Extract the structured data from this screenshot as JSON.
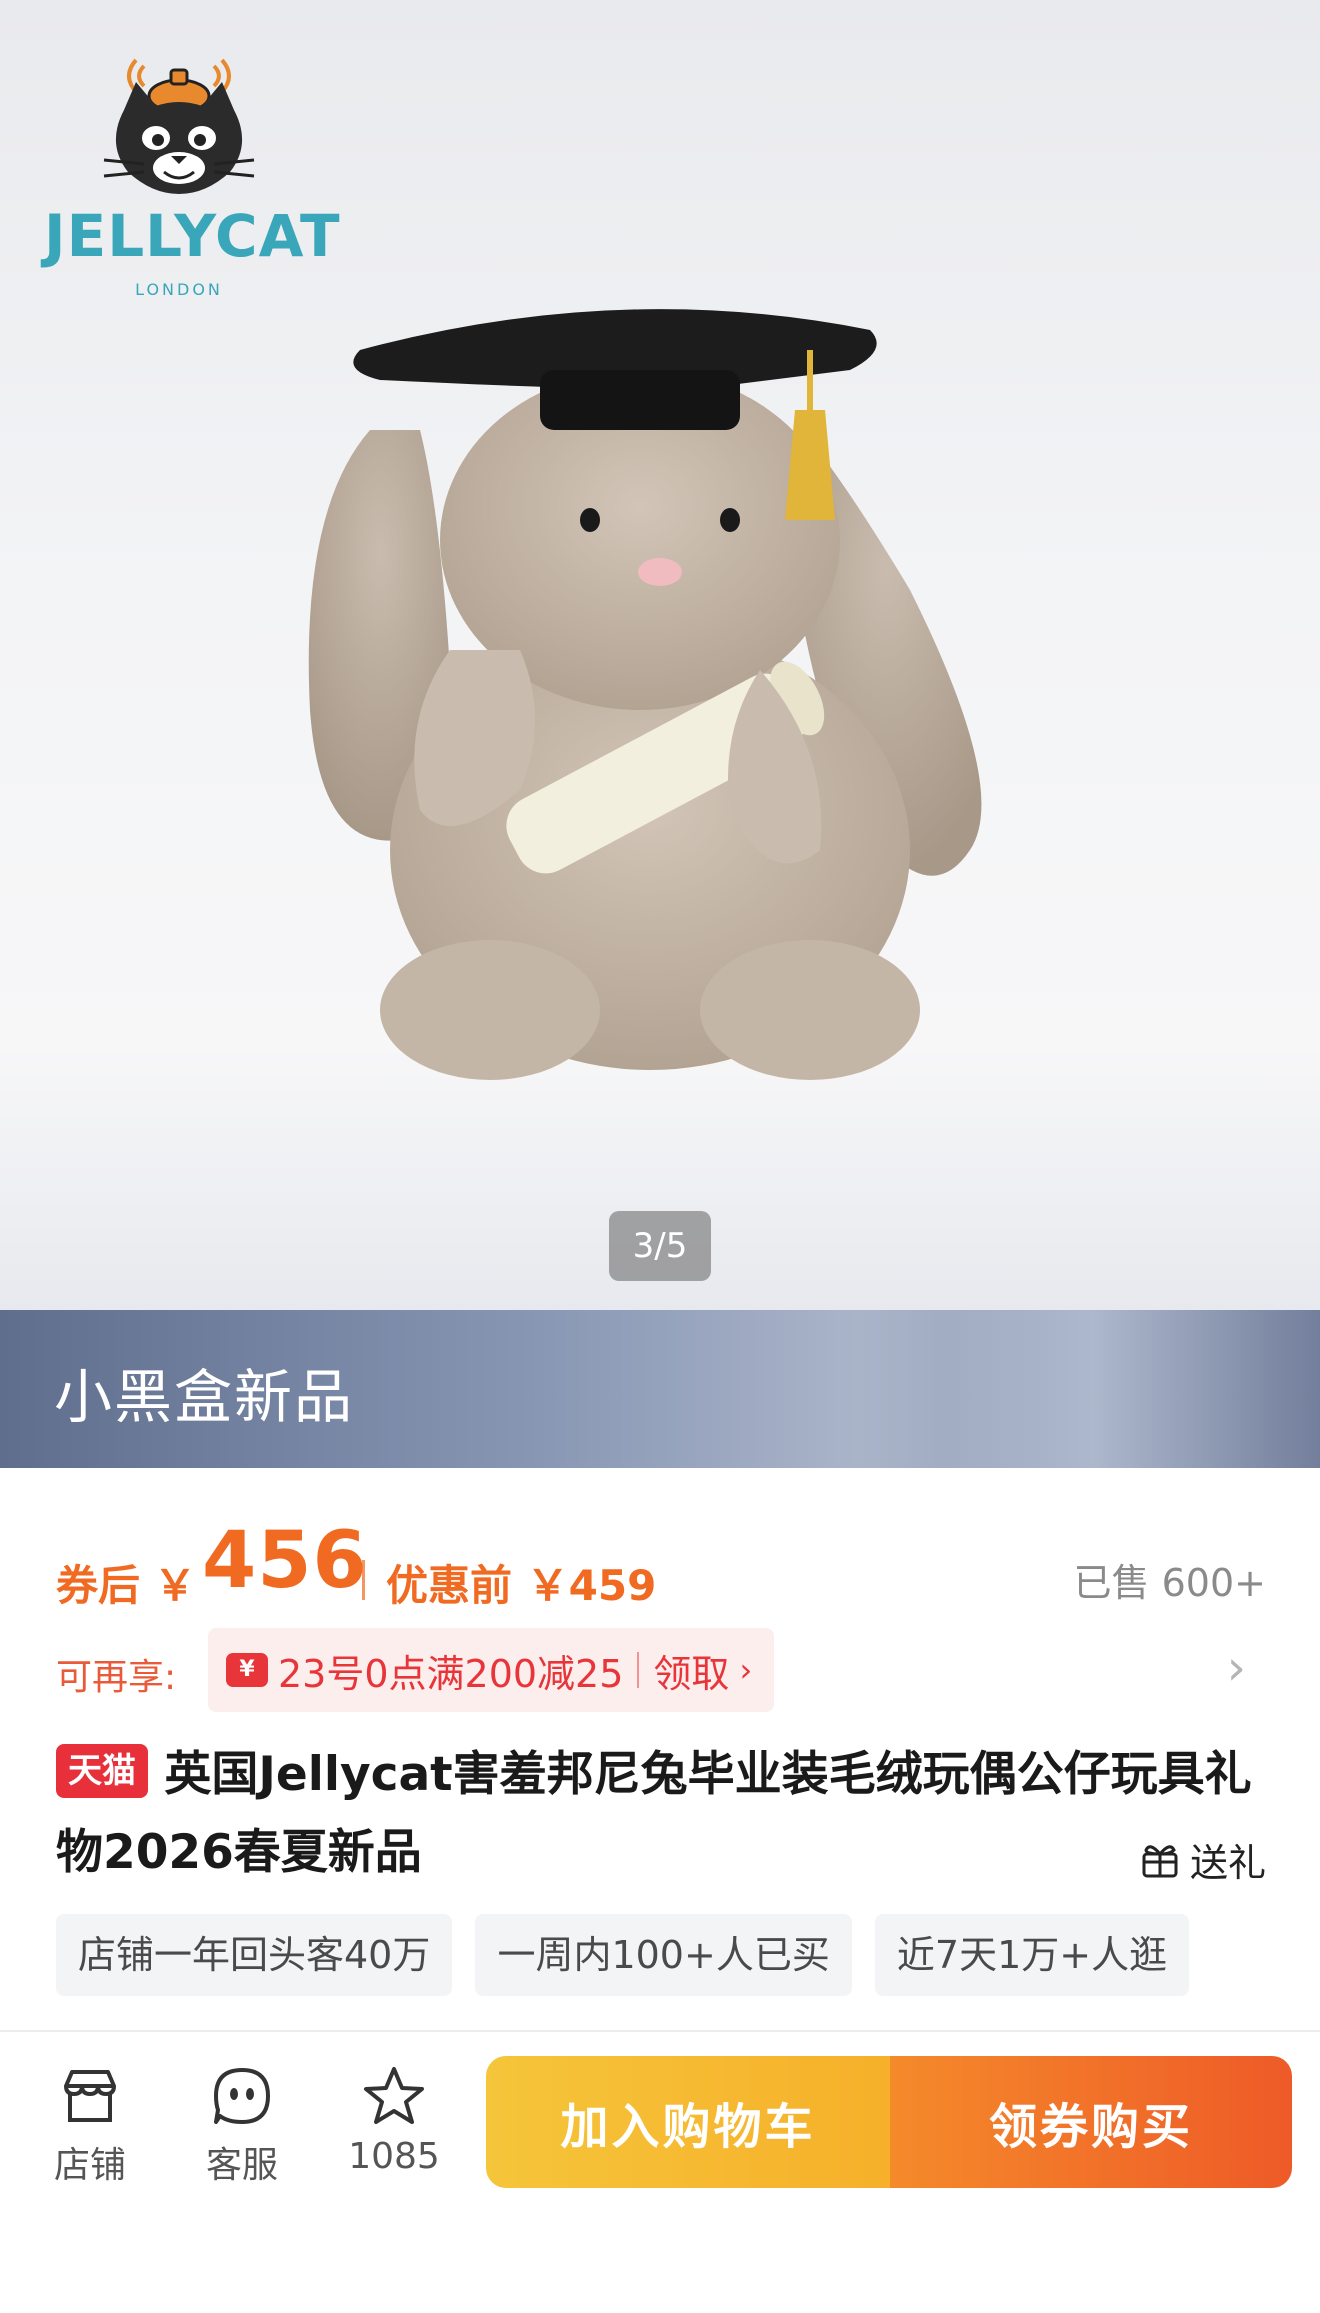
{
  "hero": {
    "brand_logo": {
      "wordmark": "JELLYCAT",
      "sub": "LONDON",
      "icon": "jellycat-cat-logo"
    },
    "image_counter": "3/5",
    "product_image": "graduation-bunny-plush"
  },
  "banner": {
    "title": "小黑盒新品"
  },
  "price": {
    "after_coupon_label": "券后",
    "currency": "￥",
    "current": "456",
    "before_discount_text": "优惠前 ￥459",
    "sold": "已售 600+"
  },
  "coupon": {
    "label": "可再享:",
    "icon": "yen-coupon-icon",
    "text": "23号0点满200减25",
    "action": "领取",
    "chevron": "›",
    "row_arrow": "›"
  },
  "product": {
    "badge": "天猫",
    "title": "英国Jellycat害羞邦尼兔毕业装毛绒玩偶公仔玩具礼物2026春夏新品",
    "gift_label": "送礼"
  },
  "tags": [
    "店铺一年回头客40万",
    "一周内100+人已买",
    "近7天1万+人逛"
  ],
  "bottom_bar": {
    "store_label": "店铺",
    "service_label": "客服",
    "favorite_count": "1085",
    "add_to_cart": "加入购物车",
    "buy_with_coupon": "领券购买"
  },
  "colors": {
    "price_orange": "#f06a22",
    "coupon_red": "#e8353a",
    "tmall_red": "#e8303a",
    "cart_yellow": "#f5c53a",
    "buy_orange": "#ee5a28",
    "logo_teal": "#3aa6b9"
  }
}
